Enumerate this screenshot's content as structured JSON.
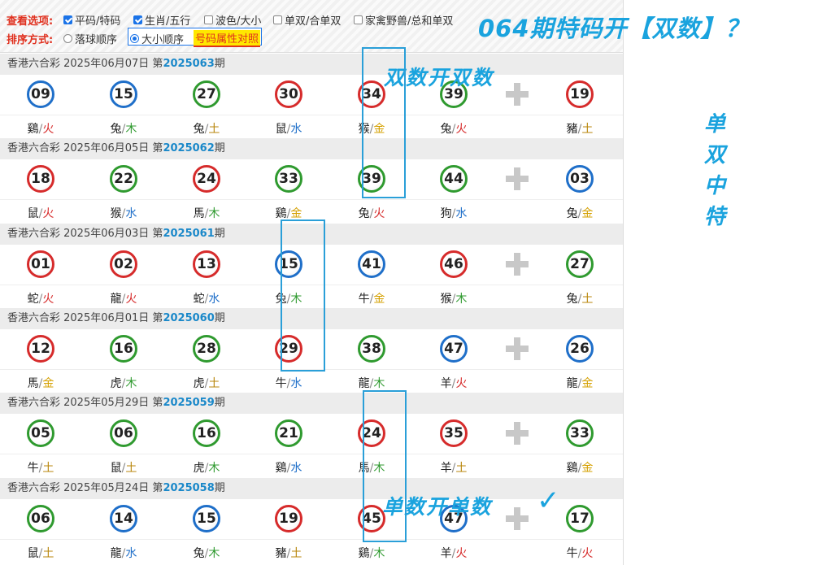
{
  "options": {
    "view_label": "查看选项:",
    "view_items": [
      {
        "label": "平码/特码",
        "checked": true
      },
      {
        "label": "生肖/五行",
        "checked": true
      },
      {
        "label": "波色/大小",
        "checked": false
      },
      {
        "label": "单双/合单双",
        "checked": false
      },
      {
        "label": "家禽野兽/总和单双",
        "checked": false
      }
    ],
    "sort_label": "排序方式:",
    "sort_items": [
      {
        "label": "落球顺序",
        "selected": false
      },
      {
        "label": "大小顺序",
        "selected": true
      }
    ],
    "attr_link": "号码属性对照"
  },
  "draws": [
    {
      "prefix": "香港六合彩 2025年06月07日 第",
      "period": "2025063",
      "suffix": "期",
      "balls": [
        {
          "n": "09",
          "c": "blue",
          "z": "鷄",
          "e": "火",
          "ek": "fire"
        },
        {
          "n": "15",
          "c": "blue",
          "z": "兔",
          "e": "木",
          "ek": "wood"
        },
        {
          "n": "27",
          "c": "green",
          "z": "兔",
          "e": "土",
          "ek": "earth"
        },
        {
          "n": "30",
          "c": "red",
          "z": "鼠",
          "e": "水",
          "ek": "water"
        },
        {
          "n": "34",
          "c": "red",
          "z": "猴",
          "e": "金",
          "ek": "metal"
        },
        {
          "n": "39",
          "c": "green",
          "z": "兔",
          "e": "火",
          "ek": "fire"
        },
        {
          "n": "19",
          "c": "red",
          "z": "豬",
          "e": "土",
          "ek": "earth"
        }
      ]
    },
    {
      "prefix": "香港六合彩 2025年06月05日 第",
      "period": "2025062",
      "suffix": "期",
      "balls": [
        {
          "n": "18",
          "c": "red",
          "z": "鼠",
          "e": "火",
          "ek": "fire"
        },
        {
          "n": "22",
          "c": "green",
          "z": "猴",
          "e": "水",
          "ek": "water"
        },
        {
          "n": "24",
          "c": "red",
          "z": "馬",
          "e": "木",
          "ek": "wood"
        },
        {
          "n": "33",
          "c": "green",
          "z": "鷄",
          "e": "金",
          "ek": "metal"
        },
        {
          "n": "39",
          "c": "green",
          "z": "兔",
          "e": "火",
          "ek": "fire"
        },
        {
          "n": "44",
          "c": "green",
          "z": "狗",
          "e": "水",
          "ek": "water"
        },
        {
          "n": "03",
          "c": "blue",
          "z": "兔",
          "e": "金",
          "ek": "metal"
        }
      ]
    },
    {
      "prefix": "香港六合彩 2025年06月03日 第",
      "period": "2025061",
      "suffix": "期",
      "balls": [
        {
          "n": "01",
          "c": "red",
          "z": "蛇",
          "e": "火",
          "ek": "fire"
        },
        {
          "n": "02",
          "c": "red",
          "z": "龍",
          "e": "火",
          "ek": "fire"
        },
        {
          "n": "13",
          "c": "red",
          "z": "蛇",
          "e": "水",
          "ek": "water"
        },
        {
          "n": "15",
          "c": "blue",
          "z": "兔",
          "e": "木",
          "ek": "wood"
        },
        {
          "n": "41",
          "c": "blue",
          "z": "牛",
          "e": "金",
          "ek": "metal"
        },
        {
          "n": "46",
          "c": "red",
          "z": "猴",
          "e": "木",
          "ek": "wood"
        },
        {
          "n": "27",
          "c": "green",
          "z": "兔",
          "e": "土",
          "ek": "earth"
        }
      ]
    },
    {
      "prefix": "香港六合彩 2025年06月01日 第",
      "period": "2025060",
      "suffix": "期",
      "balls": [
        {
          "n": "12",
          "c": "red",
          "z": "馬",
          "e": "金",
          "ek": "metal"
        },
        {
          "n": "16",
          "c": "green",
          "z": "虎",
          "e": "木",
          "ek": "wood"
        },
        {
          "n": "28",
          "c": "green",
          "z": "虎",
          "e": "土",
          "ek": "earth"
        },
        {
          "n": "29",
          "c": "red",
          "z": "牛",
          "e": "水",
          "ek": "water"
        },
        {
          "n": "38",
          "c": "green",
          "z": "龍",
          "e": "木",
          "ek": "wood"
        },
        {
          "n": "47",
          "c": "blue",
          "z": "羊",
          "e": "火",
          "ek": "fire"
        },
        {
          "n": "26",
          "c": "blue",
          "z": "龍",
          "e": "金",
          "ek": "metal"
        }
      ]
    },
    {
      "prefix": "香港六合彩 2025年05月29日 第",
      "period": "2025059",
      "suffix": "期",
      "balls": [
        {
          "n": "05",
          "c": "green",
          "z": "牛",
          "e": "土",
          "ek": "earth"
        },
        {
          "n": "06",
          "c": "green",
          "z": "鼠",
          "e": "土",
          "ek": "earth"
        },
        {
          "n": "16",
          "c": "green",
          "z": "虎",
          "e": "木",
          "ek": "wood"
        },
        {
          "n": "21",
          "c": "green",
          "z": "鷄",
          "e": "水",
          "ek": "water"
        },
        {
          "n": "24",
          "c": "red",
          "z": "馬",
          "e": "木",
          "ek": "wood"
        },
        {
          "n": "35",
          "c": "red",
          "z": "羊",
          "e": "土",
          "ek": "earth"
        },
        {
          "n": "33",
          "c": "green",
          "z": "鷄",
          "e": "金",
          "ek": "metal"
        }
      ]
    },
    {
      "prefix": "香港六合彩 2025年05月24日 第",
      "period": "2025058",
      "suffix": "期",
      "balls": [
        {
          "n": "06",
          "c": "green",
          "z": "鼠",
          "e": "土",
          "ek": "earth"
        },
        {
          "n": "14",
          "c": "blue",
          "z": "龍",
          "e": "水",
          "ek": "water"
        },
        {
          "n": "15",
          "c": "blue",
          "z": "兔",
          "e": "木",
          "ek": "wood"
        },
        {
          "n": "19",
          "c": "red",
          "z": "豬",
          "e": "土",
          "ek": "earth"
        },
        {
          "n": "45",
          "c": "red",
          "z": "鷄",
          "e": "木",
          "ek": "wood"
        },
        {
          "n": "47",
          "c": "blue",
          "z": "羊",
          "e": "火",
          "ek": "fire"
        },
        {
          "n": "17",
          "c": "green",
          "z": "牛",
          "e": "火",
          "ek": "fire"
        }
      ]
    }
  ],
  "overlay": {
    "title": "064期特码开【双数】？",
    "even_note": "双数开双数",
    "odd_note": "单数开单数",
    "check": "✓",
    "vertical": [
      "单",
      "双",
      "中",
      "特"
    ]
  }
}
